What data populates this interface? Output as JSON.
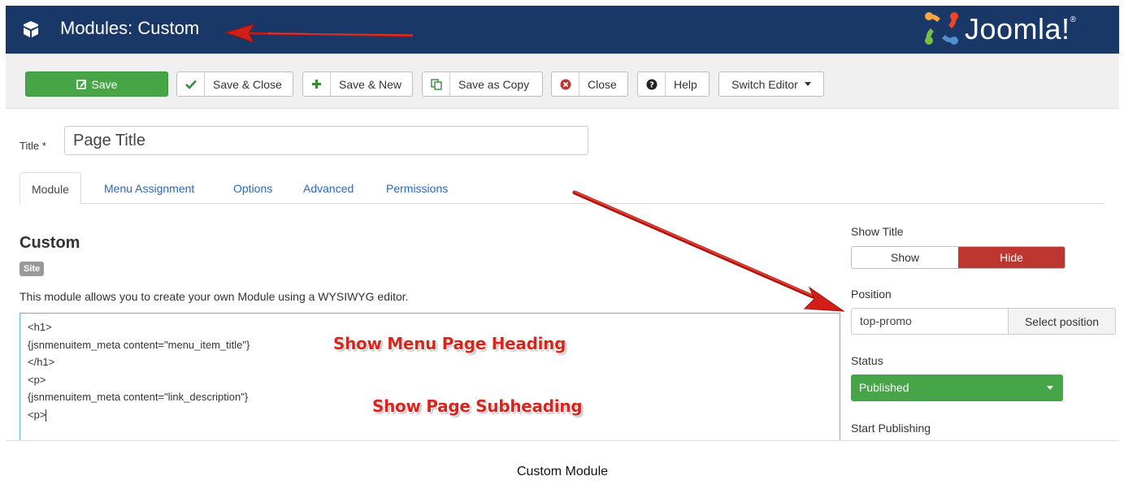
{
  "header": {
    "title": "Modules: Custom",
    "logo_text": "Joomla!",
    "bg_color": "#1a3867"
  },
  "toolbar": {
    "save_label": "Save",
    "save_close_label": "Save & Close",
    "save_new_label": "Save & New",
    "save_copy_label": "Save as Copy",
    "close_label": "Close",
    "help_label": "Help",
    "switch_editor_label": "Switch Editor",
    "save_color": "#46a546"
  },
  "form": {
    "title_label": "Title *",
    "title_value": "Page Title"
  },
  "tabs": [
    {
      "label": "Module",
      "active": true
    },
    {
      "label": "Menu Assignment",
      "active": false
    },
    {
      "label": "Options",
      "active": false
    },
    {
      "label": "Advanced",
      "active": false
    },
    {
      "label": "Permissions",
      "active": false
    }
  ],
  "module": {
    "heading": "Custom",
    "badge": "Site",
    "description": "This module allows you to create your own Module using a WYSIWYG editor."
  },
  "editor": {
    "lines": [
      "<h1>",
      "{jsnmenuitem_meta content=\"menu_item_title\"}",
      "</h1>",
      "<p>",
      "{jsnmenuitem_meta content=\"link_description\"}",
      "<p>"
    ]
  },
  "annotations": {
    "heading_note": "Show Menu Page Heading",
    "subheading_note": "Show Page Subheading",
    "arrow_color": "#d9251d"
  },
  "sidebar": {
    "show_title_label": "Show Title",
    "show_option": "Show",
    "hide_option": "Hide",
    "hide_color": "#bd362f",
    "position_label": "Position",
    "position_value": "top-promo",
    "select_position_label": "Select position",
    "status_label": "Status",
    "status_value": "Published",
    "status_color": "#46a546",
    "start_publishing_label": "Start Publishing"
  },
  "caption": "Custom Module"
}
